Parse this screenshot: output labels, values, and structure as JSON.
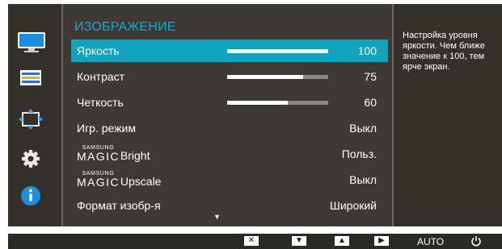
{
  "title": "ИЗОБРАЖЕНИЕ",
  "colors": {
    "accent": "#12a3bd",
    "title": "#1aa6c9",
    "panel": "#3d3935",
    "background": "#34312b"
  },
  "sidebar": {
    "icons": [
      "monitor-icon",
      "picture-settings-icon",
      "position-size-icon",
      "gear-icon",
      "info-icon"
    ]
  },
  "menu": {
    "items": [
      {
        "label": "Яркость",
        "value": "100",
        "level": 100
      },
      {
        "label": "Контраст",
        "value": "75",
        "level": 75
      },
      {
        "label": "Четкость",
        "value": "60",
        "level": 60
      },
      {
        "label": "Игр. режим",
        "value": "Выкл"
      },
      {
        "brand_small": "SAMSUNG",
        "brand_big": "MAGIC",
        "label": "Bright",
        "value": "Польз."
      },
      {
        "brand_small": "SAMSUNG",
        "brand_big": "MAGIC",
        "label": "Upscale",
        "value": "Выкл"
      },
      {
        "label": "Формат изобр-я",
        "value": "Широкий"
      }
    ],
    "scroll_indicator": "▼"
  },
  "help_text": "Настройка уровня яркости. Чем ближе значение к 100, тем ярче экран.",
  "bottom_bar": {
    "close": "✕",
    "down": "▼",
    "up": "▲",
    "enter": "▶",
    "auto": "AUTO",
    "power": "power-icon"
  }
}
